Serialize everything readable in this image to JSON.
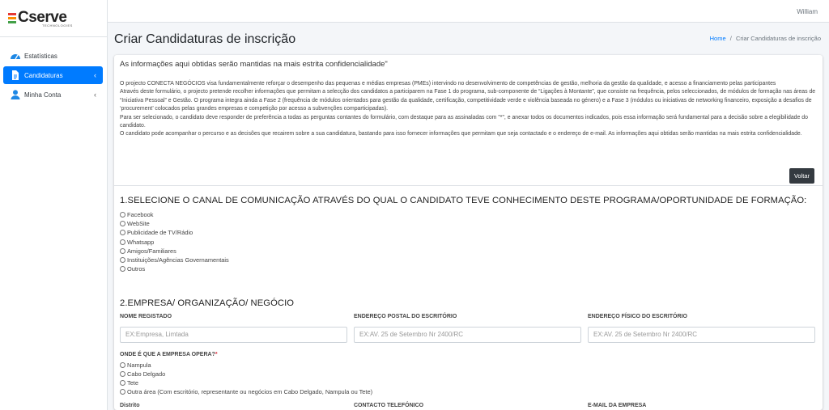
{
  "brand": {
    "name": "Cserve",
    "sub": "TECHNOLOGIES",
    "colors": [
      "#e53935",
      "#fb8c00",
      "#43a047"
    ]
  },
  "sidebar": {
    "items": [
      {
        "label": "Estatísticas",
        "icon": "gauge-icon",
        "active": false
      },
      {
        "label": "Candidaturas",
        "icon": "file-icon",
        "active": true
      },
      {
        "label": "Minha Conta",
        "icon": "user-icon",
        "active": false
      }
    ]
  },
  "topbar": {
    "user": "William"
  },
  "header": {
    "title": "Criar Candidaturas de inscrição",
    "breadcrumb_home": "Home",
    "breadcrumb_sep": "/",
    "breadcrumb_current": "Criar Candidaturas de inscrição"
  },
  "notice": "As informações aqui obtidas serão mantidas na mais estrita confidencialidade\"",
  "intro": [
    "O projecto CONECTA NEGÓCIOS visa fundamentalmente reforçar o desempenho das pequenas e médias empresas (PMEs) intervindo no desenvolvimento de competências de gestão, melhoria da gestão da qualidade, e acesso a financiamento pelas participantes",
    "Através deste formulário, o projecto pretende recolher informações que permitam a selecção dos candidatos a participarem na Fase 1 do programa, sub-componente de “Ligações à Montante”, que consiste na frequência, pelos seleccionados, de módulos de formação nas áreas de “Iniciativa Pessoal” e Gestão. O programa integra ainda a Fase 2 (frequência de módulos orientados para gestão da qualidade, certificação, competitividade verde e violência baseada no género) e a Fase 3 (módulos ou iniciativas de networking financeiro, exposição a desafios de ‘procurement’ colocados pelas grandes empresas e competição por acesso a subvenções comparticipadas).",
    "Para ser selecionado, o candidato deve responder de preferência a todas as perguntas contantes do formulário, com destaque para as assinaladas com \"*\", e anexar todos os documentos indicados, pois essa informação será fundamental para a decisão sobre a elegibilidade do candidato.",
    "O candidato pode acompanhar o percurso e as decisões que recairem sobre a sua candidatura, bastando para isso fornecer informações que permitam que seja contactado e o endereço de e-mail. As informações aqui obtidas serão mantidas na mais estrita confidencialidade."
  ],
  "voltar": "Voltar",
  "section1": {
    "title": "1.SELECIONE O CANAL DE COMUNICAÇÃO ATRAVÉS DO QUAL O CANDIDATO TEVE CONHECIMENTO DESTE PROGRAMA/OPORTUNIDADE DE FORMAÇÃO:",
    "options": [
      "Facebook",
      "WebSite",
      "Publicidade de TV/Rádio",
      "Whatsapp",
      "Amigos/Familiares",
      "Instituições/Agências Governamentais",
      "Outros"
    ]
  },
  "section2": {
    "title": "2.EMPRESA/ ORGANIZAÇÃO/ NEGÓCIO",
    "fields": [
      {
        "label": "NOME REGISTADO",
        "placeholder": "EX:Empresa, Limtada"
      },
      {
        "label": "ENDEREÇO POSTAL DO ESCRITÓRIO",
        "placeholder": "EX:AV. 25 de Setembro Nr 2400/RC"
      },
      {
        "label": "ENDEREÇO FÍSICO DO ESCRITÓRIO",
        "placeholder": "EX:AV. 25 de Setembro Nr 2400/RC"
      }
    ],
    "opera_label": "ONDE É QUE A EMPRESA OPERA?",
    "opera_required": "*",
    "opera_options": [
      "Nampula",
      "Cabo Delgado",
      "Tete",
      "Outra área (Com escritório, representante ou negócios em Cabo Delgado, Nampula ou Tete)"
    ],
    "bottom_labels": [
      "Distrito",
      "CONTACTO TELEFÓNICO",
      "E-MAIL DA EMPRESA"
    ]
  }
}
